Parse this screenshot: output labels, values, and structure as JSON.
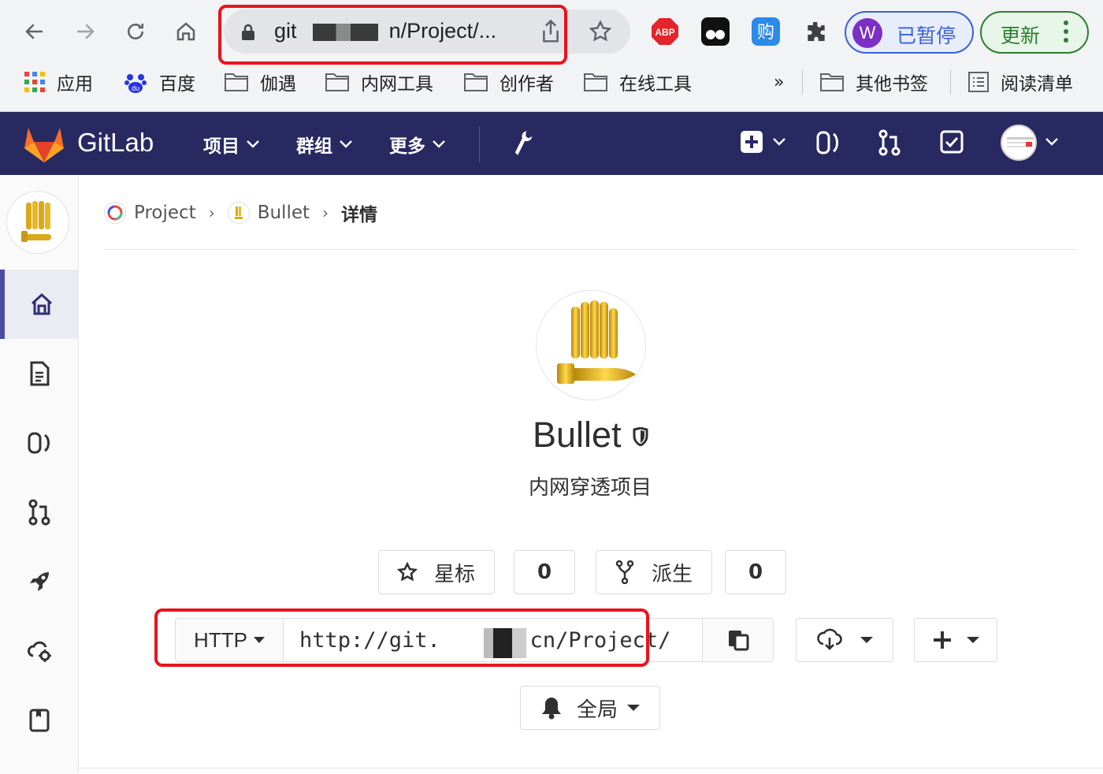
{
  "browser": {
    "url_prefix": "git",
    "url_suffix": "n/Project/...",
    "profile_initial": "W",
    "profile_status": "已暂停",
    "update_label": "更新",
    "bookmarks": [
      {
        "label": "应用",
        "icon": "apps-grid-icon"
      },
      {
        "label": "百度",
        "icon": "baidu-icon"
      },
      {
        "label": "伽遇",
        "icon": "folder-icon"
      },
      {
        "label": "内网工具",
        "icon": "folder-icon"
      },
      {
        "label": "创作者",
        "icon": "folder-icon"
      },
      {
        "label": "在线工具",
        "icon": "folder-icon"
      }
    ],
    "bookmarks_more": "»",
    "other_bookmarks": "其他书签",
    "reading_list": "阅读清单"
  },
  "gitlab": {
    "brand": "GitLab",
    "menu": [
      "项目",
      "群组",
      "更多"
    ]
  },
  "breadcrumb": {
    "group": "Project",
    "project": "Bullet",
    "current": "详情"
  },
  "project": {
    "name": "Bullet",
    "description": "内网穿透项目",
    "star_label": "星标",
    "star_count": "0",
    "fork_label": "派生",
    "fork_count": "0",
    "clone_protocol": "HTTP",
    "clone_url": "http://git.      .cn/Project/",
    "notification_label": "全局"
  },
  "colors": {
    "gitlab_header": "#292961",
    "highlight_red": "#e8141c",
    "sidebar_active": "#4b4ba3"
  }
}
